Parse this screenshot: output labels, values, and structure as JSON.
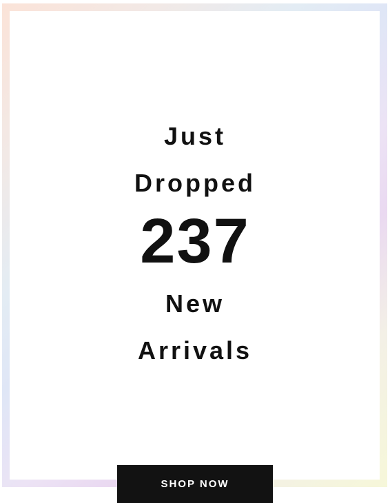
{
  "promo": {
    "line1": "Just",
    "line2": "Dropped",
    "count": "237",
    "line4": "New",
    "line5": "Arrivals"
  },
  "cta": {
    "label": "SHOP NOW"
  },
  "colors": {
    "text": "#111111",
    "button_bg": "#121212",
    "button_text": "#ffffff",
    "frame_gradient": [
      "#fbe3d8",
      "#e3ecf4",
      "#ead9f1",
      "#f6f7d9"
    ]
  }
}
